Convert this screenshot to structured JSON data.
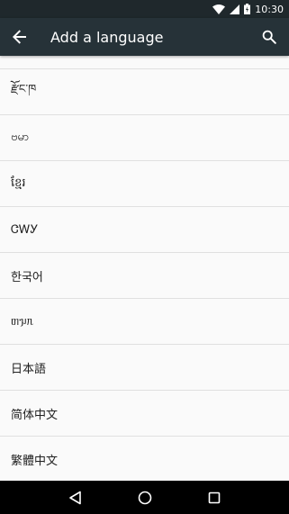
{
  "status_bar": {
    "time": "10:30",
    "icons": [
      "wifi-icon",
      "signal-icon",
      "battery-icon"
    ]
  },
  "app_bar": {
    "title": "Add a language",
    "back_icon": "back-arrow-icon",
    "search_icon": "search-icon"
  },
  "languages": [
    {
      "label": "རྫོང་ཁ"
    },
    {
      "label": "ဗမာ"
    },
    {
      "label": "ខ្មែរ"
    },
    {
      "label": "ᏣᎳᎩ"
    },
    {
      "label": "한국어"
    },
    {
      "label": "ᥖᥭᥰ"
    },
    {
      "label": "日本語"
    },
    {
      "label": "简体中文"
    },
    {
      "label": "繁體中文"
    }
  ],
  "nav_bar": {
    "icons": [
      "back-triangle-icon",
      "home-circle-icon",
      "recents-square-icon"
    ]
  }
}
